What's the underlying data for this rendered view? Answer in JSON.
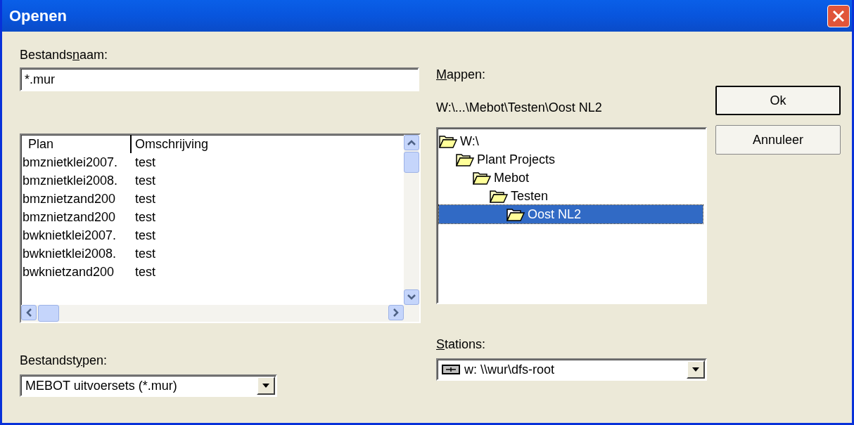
{
  "window": {
    "title": "Openen"
  },
  "file_name": {
    "label": {
      "before": "Bestands",
      "key": "n",
      "after": "aam:"
    },
    "value": "*.mur"
  },
  "file_list": {
    "columns": [
      "Plan",
      "Omschrijving"
    ],
    "rows": [
      {
        "plan": "bmznietklei2007.",
        "description": "test"
      },
      {
        "plan": "bmznietklei2008.",
        "description": "test"
      },
      {
        "plan": "bmznietzand200",
        "description": "test"
      },
      {
        "plan": "bmznietzand200",
        "description": "test"
      },
      {
        "plan": "bwknietklei2007.",
        "description": "test"
      },
      {
        "plan": "bwknietklei2008.",
        "description": "test"
      },
      {
        "plan": "bwknietzand200",
        "description": "test"
      }
    ]
  },
  "file_types": {
    "label": {
      "before": "Bestandst",
      "key": "y",
      "after": "pen:"
    },
    "value": "MEBOT uitvoersets (*.mur)"
  },
  "folders": {
    "label": {
      "key": "M",
      "after": "appen:"
    },
    "path": "W:\\...\\Mebot\\Testen\\Oost NL2",
    "tree": [
      {
        "label": "W:\\",
        "selected": false,
        "children": [
          {
            "label": "Plant Projects",
            "selected": false,
            "children": [
              {
                "label": "Mebot",
                "selected": false,
                "children": [
                  {
                    "label": "Testen",
                    "selected": false,
                    "children": [
                      {
                        "label": "Oost NL2",
                        "selected": true
                      }
                    ]
                  }
                ]
              }
            ]
          }
        ]
      }
    ]
  },
  "drives": {
    "label": {
      "key": "S",
      "after": "tations:"
    },
    "value": "w: \\\\wur\\dfs-root"
  },
  "buttons": [
    {
      "label": "Ok",
      "default": true
    },
    {
      "label": "Annuleer",
      "default": false
    }
  ]
}
